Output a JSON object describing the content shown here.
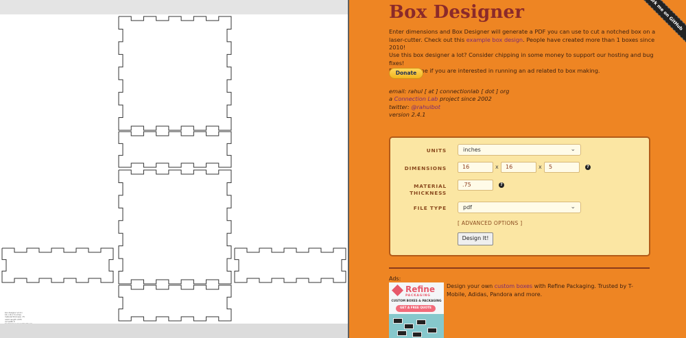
{
  "preview": {
    "notes": [
      "box designer v2.4.1",
      "16 x 16 x 5 inches",
      "material thickness .75",
      "notch length 1.875",
      "cut width 0",
      "boxdesigner.connectionlab.org"
    ]
  },
  "header": {
    "title": "Box Designer",
    "github_ribbon": "Fork me on GitHub"
  },
  "intro": {
    "text_before": "Enter dimensions and Box Designer will generate a PDF you can use to cut a notched box on a laser-cutter. Check out this ",
    "link": "example box design",
    "text_after": ". People have created more than 1 boxes since 2010!"
  },
  "support": {
    "line1": "Use this box designer a lot? Consider chipping in some money to support our hosting and bug fixes!",
    "line2": "Drop us a line if you are interested in running an ad related to box making.",
    "donate_label": "Donate"
  },
  "credits": {
    "email": "email: rahul [ at ] connectionlab [ dot ] org",
    "project_before": "a ",
    "project_link": "Connection Lab",
    "project_after": " project since 2002",
    "twitter_prefix": "twitter: ",
    "twitter_handle": "@rahulbot",
    "version": "version 2.4.1"
  },
  "form": {
    "units_label": "UNITS",
    "units_value": "inches",
    "dimensions_label": "DIMENSIONS",
    "width": "16",
    "height": "16",
    "depth": "5",
    "times": "x",
    "thickness_label_1": "MATERIAL",
    "thickness_label_2": "THICKNESS",
    "thickness": ".75",
    "filetype_label": "FILE TYPE",
    "filetype_value": "pdf",
    "advanced": "[ ADVANCED OPTIONS ]",
    "submit": "Design It!",
    "help_glyph": "?"
  },
  "ads": {
    "label": "Ads:",
    "image_brand": "Refine",
    "image_brand_sub": "PACKAGING",
    "image_tag": "CUSTOM BOXES & PACKAGING",
    "image_cta": "GET A FREE QUOTE",
    "text_before": "Design your own ",
    "text_link": "custom boxes",
    "text_after": " with Refine Packaging. Trusted by T-Mobile, Adidas, Pandora and more."
  },
  "colors": {
    "panel_bg": "#ee8523",
    "title": "#8b2a2a",
    "link": "#7a2a76",
    "form_bg": "#fbe6a3",
    "form_border": "#b25a18"
  }
}
